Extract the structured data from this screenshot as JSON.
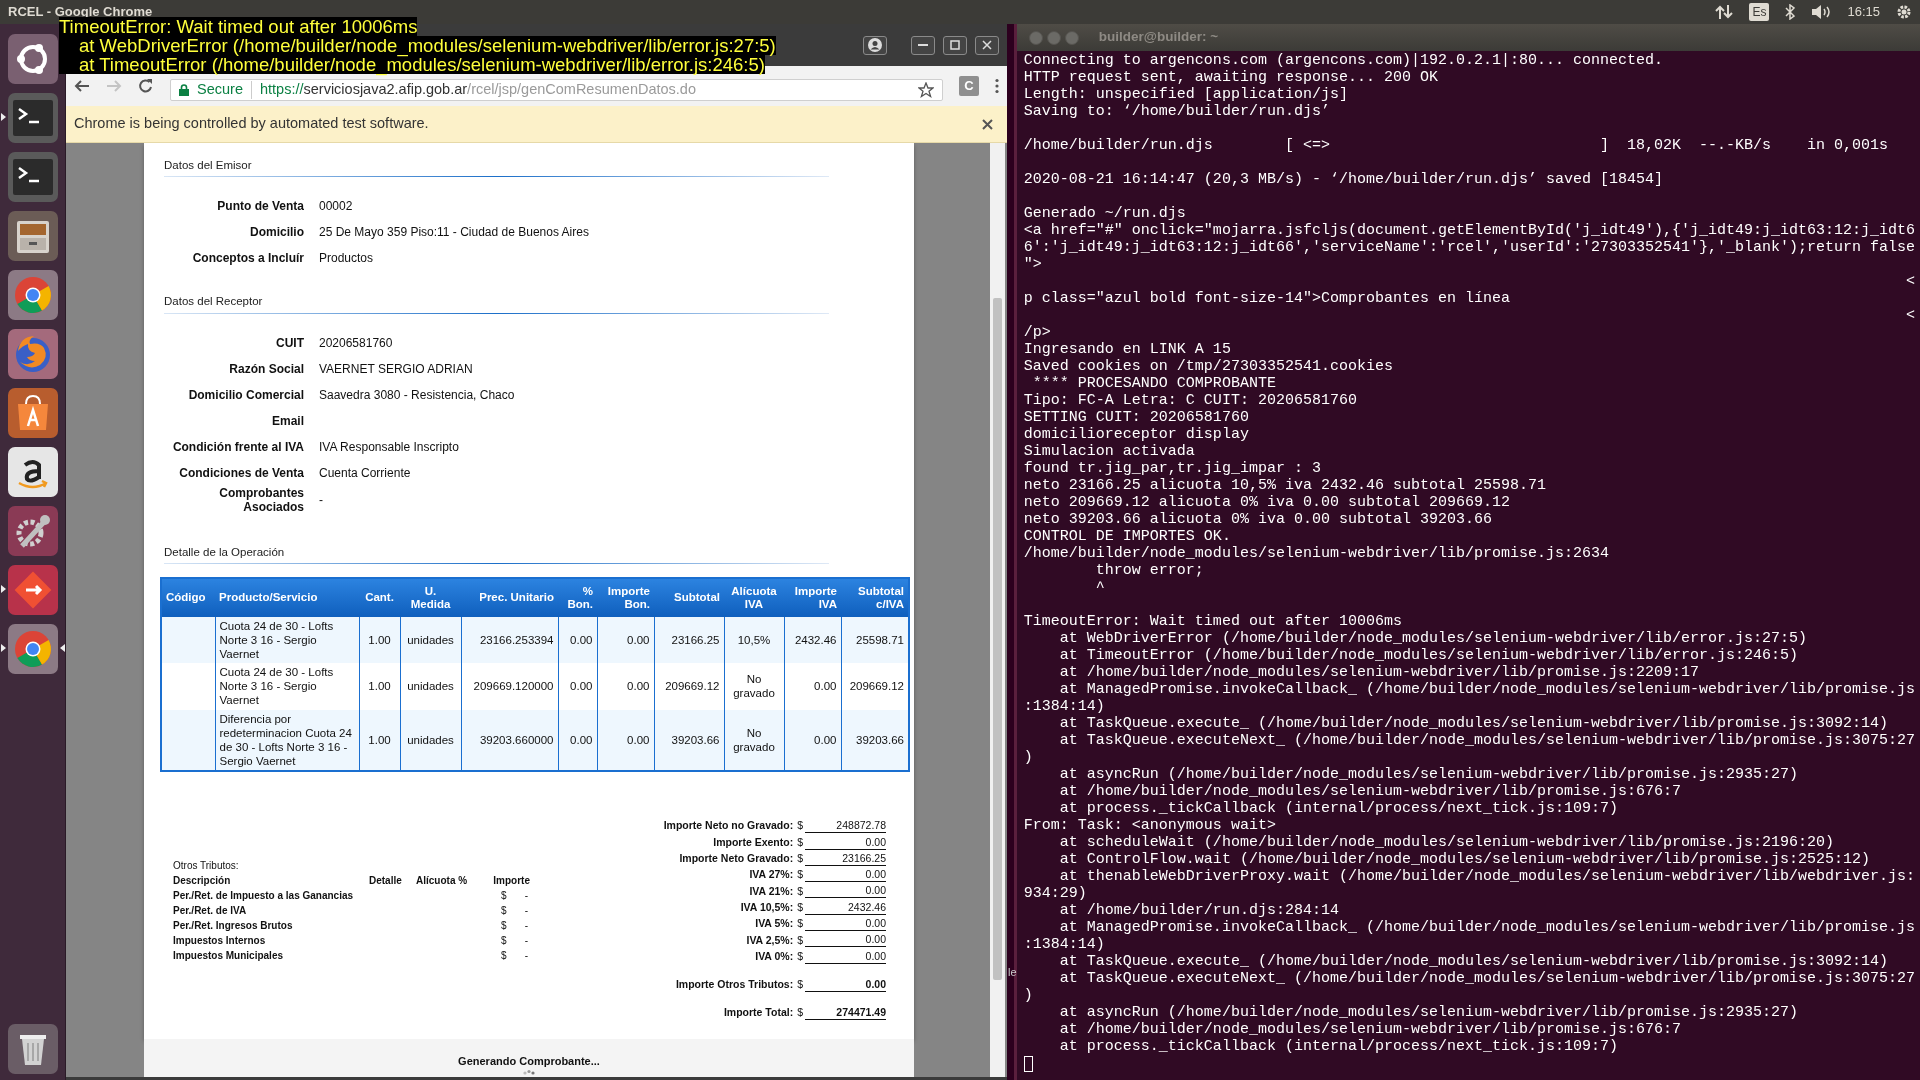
{
  "top_bar": {
    "title": "RCEL - Google Chrome",
    "keyboard_layout": "Es",
    "clock": "16:15"
  },
  "launcher": {
    "items": [
      {
        "kind": "ubuntu",
        "running": false,
        "focused": false
      },
      {
        "kind": "terminal",
        "running": true,
        "focused": false
      },
      {
        "kind": "terminal",
        "running": false,
        "focused": false
      },
      {
        "kind": "files",
        "running": false,
        "focused": false
      },
      {
        "kind": "chrome",
        "running": false,
        "focused": false
      },
      {
        "kind": "firefox",
        "running": false,
        "focused": false
      },
      {
        "kind": "software",
        "running": false,
        "focused": false
      },
      {
        "kind": "amazon",
        "running": false,
        "focused": false
      },
      {
        "kind": "settings",
        "running": false,
        "focused": false
      },
      {
        "kind": "git",
        "running": true,
        "focused": false
      },
      {
        "kind": "chrome",
        "running": true,
        "focused": true
      },
      {
        "kind": "trash",
        "running": false,
        "focused": false
      }
    ]
  },
  "error_overlay": {
    "message": "TimeoutError: Wait timed out after 10006ms",
    "stack": [
      "at WebDriverError (/home/builder/node_modules/selenium-webdriver/lib/error.js:27:5)",
      "at TimeoutError (/home/builder/node_modules/selenium-webdriver/lib/error.js:246:5)"
    ]
  },
  "browser": {
    "address": {
      "security": "Secure",
      "scheme": "https://",
      "host": "serviciosjava2.afip.gob.ar",
      "path": "/rcel/jsp/genComResumenDatos.do"
    },
    "extension": "C",
    "infobar": "Chrome is being controlled by automated test software.",
    "page": {
      "emisor": {
        "title": "Datos del Emisor",
        "fields": [
          {
            "label": "Punto de Venta",
            "value": "00002"
          },
          {
            "label": "Domicilio",
            "value": "25 De Mayo 359 Piso:11 - Ciudad de Buenos Aires"
          },
          {
            "label": "Conceptos a Incluír",
            "value": "Productos"
          }
        ]
      },
      "receptor": {
        "title": "Datos del Receptor",
        "fields": [
          {
            "label": "CUIT",
            "value": "20206581760"
          },
          {
            "label": "Razón Social",
            "value": "VAERNET SERGIO ADRIAN"
          },
          {
            "label": "Domicilio Comercial",
            "value": "Saavedra 3080 - Resistencia, Chaco"
          },
          {
            "label": "Email"
          },
          {
            "label": "Condición frente al IVA",
            "value": "IVA Responsable Inscripto"
          },
          {
            "label": "Condiciones de Venta",
            "value": "Cuenta Corriente"
          },
          {
            "label": "Comprobantes Asociados",
            "value": "-"
          }
        ]
      },
      "detalle": {
        "title": "Detalle de la Operación",
        "columns": [
          "Código",
          "Producto/Servicio",
          "Cant.",
          "U. Medida",
          "Prec. Unitario",
          "% Bon.",
          "Importe Bon.",
          "Subtotal",
          "Alícuota IVA",
          "Importe IVA",
          "Subtotal c/IVA"
        ],
        "rows": [
          {
            "producto": "Cuota 24 de 30 - Lofts Norte 3 16 - Sergio Vaernet",
            "cantidad": "1.00",
            "unidad": "unidades",
            "precio_unitario": "23166.253394",
            "bonificacion_pct": "0.00",
            "importe_bonificacion": "0.00",
            "subtotal": "23166.25",
            "alicuota_iva": "10,5%",
            "importe_iva": "2432.46",
            "subtotal_con_iva": "25598.71"
          },
          {
            "producto": "Cuota 24 de 30 - Lofts Norte 3 16 - Sergio Vaernet",
            "cantidad": "1.00",
            "unidad": "unidades",
            "precio_unitario": "209669.120000",
            "bonificacion_pct": "0.00",
            "importe_bonificacion": "0.00",
            "subtotal": "209669.12",
            "alicuota_iva": "No gravado",
            "importe_iva": "0.00",
            "subtotal_con_iva": "209669.12"
          },
          {
            "producto": "Diferencia por redeterminacion Cuota 24 de 30 - Lofts Norte 3 16 - Sergio Vaernet",
            "cantidad": "1.00",
            "unidad": "unidades",
            "precio_unitario": "39203.660000",
            "bonificacion_pct": "0.00",
            "importe_bonificacion": "0.00",
            "subtotal": "39203.66",
            "alicuota_iva": "No gravado",
            "importe_iva": "0.00",
            "subtotal_con_iva": "39203.66"
          }
        ]
      },
      "otros_tributos": {
        "title": "Otros Tributos:",
        "columns": [
          "Descripción",
          "Detalle",
          "Alícuota %",
          "Importe"
        ],
        "rows": [
          {
            "descripcion": "Per./Ret. de Impuesto a las Ganancias",
            "currency": "$",
            "importe": "-"
          },
          {
            "descripcion": "Per./Ret. de IVA",
            "currency": "$",
            "importe": "-"
          },
          {
            "descripcion": "Per./Ret. Ingresos Brutos",
            "currency": "$",
            "importe": "-"
          },
          {
            "descripcion": "Impuestos Internos",
            "currency": "$",
            "importe": "-"
          },
          {
            "descripcion": "Impuestos Municipales",
            "currency": "$",
            "importe": "-"
          }
        ]
      },
      "totales": [
        {
          "kind": "line",
          "label": "Importe Neto no Gravado:",
          "currency": "$",
          "value": "248872.78"
        },
        {
          "kind": "line",
          "label": "Importe Exento:",
          "currency": "$",
          "value": "0.00"
        },
        {
          "kind": "line",
          "label": "Importe Neto Gravado:",
          "currency": "$",
          "value": "23166.25"
        },
        {
          "kind": "line",
          "label": "IVA 27%:",
          "currency": "$",
          "value": "0.00"
        },
        {
          "kind": "line",
          "label": "IVA 21%:",
          "currency": "$",
          "value": "0.00"
        },
        {
          "kind": "line",
          "label": "IVA 10,5%:",
          "currency": "$",
          "value": "2432.46"
        },
        {
          "kind": "line",
          "label": "IVA 5%:",
          "currency": "$",
          "value": "0.00"
        },
        {
          "kind": "line",
          "label": "IVA 2,5%:",
          "currency": "$",
          "value": "0.00"
        },
        {
          "kind": "line",
          "label": "IVA 0%:",
          "currency": "$",
          "value": "0.00"
        },
        {
          "kind": "summary",
          "label": "Importe Otros Tributos:",
          "currency": "$",
          "value": "0.00"
        },
        {
          "kind": "summary",
          "label": "Importe Total:",
          "currency": "$",
          "value": "274471.49"
        }
      ],
      "status": "Generando Comprobante..."
    }
  },
  "desktop_fragment": "le",
  "terminal": {
    "title": "builder@builder: ~",
    "lines": [
      {
        "kind": "line",
        "text": "Connecting to argencons.com (argencons.com)|192.0.2.1|:80... connected."
      },
      {
        "kind": "line",
        "text": "HTTP request sent, awaiting response... 200 OK"
      },
      {
        "kind": "line",
        "text": "Length: unspecified [application/js]"
      },
      {
        "kind": "line",
        "text": "Saving to: ‘/home/builder/run.djs’"
      },
      {
        "kind": "blank"
      },
      {
        "kind": "line",
        "text": "/home/builder/run.djs        [ <=>                              ]  18,02K  --.-KB/s    in 0,001s"
      },
      {
        "kind": "blank"
      },
      {
        "kind": "line",
        "text": "2020-08-21 16:14:47 (20,3 MB/s) - ‘/home/builder/run.djs’ saved [18454]"
      },
      {
        "kind": "blank"
      },
      {
        "kind": "line",
        "text": "Generado ~/run.djs"
      },
      {
        "kind": "line",
        "text": "<a href=\"#\" onclick=\"mojarra.jsfcljs(document.getElementById('j_idt49'),{'j_idt49:j_idt63:12:j_idt6"
      },
      {
        "kind": "line",
        "text": "6':'j_idt49:j_idt63:12:j_idt66','serviceName':'rcel','userId':'27303352541'},'_blank');return false"
      },
      {
        "kind": "line",
        "text": "\">"
      },
      {
        "kind": "edge",
        "text": "<"
      },
      {
        "kind": "line",
        "text": "p class=\"azul bold font-size-14\">Comprobantes en línea"
      },
      {
        "kind": "edge",
        "text": "<"
      },
      {
        "kind": "line",
        "text": "/p>"
      },
      {
        "kind": "line",
        "text": "Ingresando en LINK A 15"
      },
      {
        "kind": "line",
        "text": "Saved cookies on /tmp/27303352541.cookies"
      },
      {
        "kind": "line",
        "text": " **** PROCESANDO COMPROBANTE"
      },
      {
        "kind": "line",
        "text": "Tipo: FC-A Letra: C CUIT: 20206581760"
      },
      {
        "kind": "line",
        "text": "SETTING CUIT: 20206581760"
      },
      {
        "kind": "line",
        "text": "domicilioreceptor display"
      },
      {
        "kind": "line",
        "text": "Simulacion activada"
      },
      {
        "kind": "line",
        "text": "found tr.jig_par,tr.jig_impar : 3"
      },
      {
        "kind": "line",
        "text": "neto 23166.25 alicuota 10,5% iva 2432.46 subtotal 25598.71"
      },
      {
        "kind": "line",
        "text": "neto 209669.12 alicuota 0% iva 0.00 subtotal 209669.12"
      },
      {
        "kind": "line",
        "text": "neto 39203.66 alicuota 0% iva 0.00 subtotal 39203.66"
      },
      {
        "kind": "line",
        "text": "CONTROL DE IMPORTES OK."
      },
      {
        "kind": "line",
        "text": "/home/builder/node_modules/selenium-webdriver/lib/promise.js:2634"
      },
      {
        "kind": "line",
        "text": "        throw error;"
      },
      {
        "kind": "line",
        "text": "        ^"
      },
      {
        "kind": "blank"
      },
      {
        "kind": "line",
        "text": "TimeoutError: Wait timed out after 10006ms"
      },
      {
        "kind": "line",
        "text": "    at WebDriverError (/home/builder/node_modules/selenium-webdriver/lib/error.js:27:5)"
      },
      {
        "kind": "line",
        "text": "    at TimeoutError (/home/builder/node_modules/selenium-webdriver/lib/error.js:246:5)"
      },
      {
        "kind": "line",
        "text": "    at /home/builder/node_modules/selenium-webdriver/lib/promise.js:2209:17"
      },
      {
        "kind": "line",
        "text": "    at ManagedPromise.invokeCallback_ (/home/builder/node_modules/selenium-webdriver/lib/promise.js"
      },
      {
        "kind": "line",
        "text": ":1384:14)"
      },
      {
        "kind": "line",
        "text": "    at TaskQueue.execute_ (/home/builder/node_modules/selenium-webdriver/lib/promise.js:3092:14)"
      },
      {
        "kind": "line",
        "text": "    at TaskQueue.executeNext_ (/home/builder/node_modules/selenium-webdriver/lib/promise.js:3075:27"
      },
      {
        "kind": "line",
        "text": ")"
      },
      {
        "kind": "line",
        "text": "    at asyncRun (/home/builder/node_modules/selenium-webdriver/lib/promise.js:2935:27)"
      },
      {
        "kind": "line",
        "text": "    at /home/builder/node_modules/selenium-webdriver/lib/promise.js:676:7"
      },
      {
        "kind": "line",
        "text": "    at process._tickCallback (internal/process/next_tick.js:109:7)"
      },
      {
        "kind": "line",
        "text": "From: Task: <anonymous wait>"
      },
      {
        "kind": "line",
        "text": "    at scheduleWait (/home/builder/node_modules/selenium-webdriver/lib/promise.js:2196:20)"
      },
      {
        "kind": "line",
        "text": "    at ControlFlow.wait (/home/builder/node_modules/selenium-webdriver/lib/promise.js:2525:12)"
      },
      {
        "kind": "line",
        "text": "    at thenableWebDriverProxy.wait (/home/builder/node_modules/selenium-webdriver/lib/webdriver.js:"
      },
      {
        "kind": "line",
        "text": "934:29)"
      },
      {
        "kind": "line",
        "text": "    at /home/builder/run.djs:284:14"
      },
      {
        "kind": "line",
        "text": "    at ManagedPromise.invokeCallback_ (/home/builder/node_modules/selenium-webdriver/lib/promise.js"
      },
      {
        "kind": "line",
        "text": ":1384:14)"
      },
      {
        "kind": "line",
        "text": "    at TaskQueue.execute_ (/home/builder/node_modules/selenium-webdriver/lib/promise.js:3092:14)"
      },
      {
        "kind": "line",
        "text": "    at TaskQueue.executeNext_ (/home/builder/node_modules/selenium-webdriver/lib/promise.js:3075:27"
      },
      {
        "kind": "line",
        "text": ")"
      },
      {
        "kind": "line",
        "text": "    at asyncRun (/home/builder/node_modules/selenium-webdriver/lib/promise.js:2935:27)"
      },
      {
        "kind": "line",
        "text": "    at /home/builder/node_modules/selenium-webdriver/lib/promise.js:676:7"
      },
      {
        "kind": "line",
        "text": "    at process._tickCallback (internal/process/next_tick.js:109:7)"
      }
    ]
  }
}
